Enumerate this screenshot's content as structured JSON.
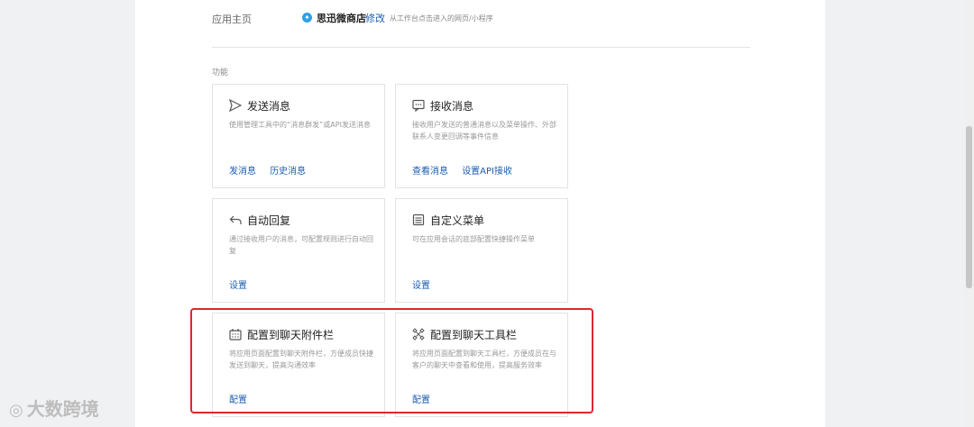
{
  "homepage": {
    "label": "应用主页",
    "app_name": "思迅微商店",
    "edit_label": "修改",
    "hint": "从工作台点击进入的网页/小程序"
  },
  "section": {
    "title": "功能"
  },
  "cards": [
    {
      "title": "发送消息",
      "icon": "send-icon",
      "desc": "使用管理工具中的“消息群发”或API发送消息",
      "links": [
        "发消息",
        "历史消息"
      ]
    },
    {
      "title": "接收消息",
      "icon": "message-icon",
      "desc": "接收用户发送的普通消息以及菜单操作、外部联系人变更回调等事件信息",
      "links": [
        "查看消息",
        "设置API接收"
      ]
    },
    {
      "title": "自动回复",
      "icon": "reply-icon",
      "desc": "通过接收用户的消息，可配置规则进行自动回复",
      "links": [
        "设置"
      ]
    },
    {
      "title": "自定义菜单",
      "icon": "menu-icon",
      "desc": "可在应用会话的底部配置快捷操作菜单",
      "links": [
        "设置"
      ]
    },
    {
      "title": "配置到聊天附件栏",
      "icon": "attachment-bar-icon",
      "desc": "将应用页面配置到聊天附件栏，方便成员快捷发送到聊天，提高沟通效率",
      "links": [
        "配置"
      ]
    },
    {
      "title": "配置到聊天工具栏",
      "icon": "toolbar-icon",
      "desc": "将应用页面配置到聊天工具栏，方便成员在与客户的聊天中查看和使用，提高服务效率",
      "links": [
        "配置"
      ]
    }
  ],
  "watermark": {
    "text": "大数跨境"
  },
  "colors": {
    "link": "#1d5db0",
    "highlight": "#e0272c",
    "app_icon": "#2aa0e8"
  }
}
